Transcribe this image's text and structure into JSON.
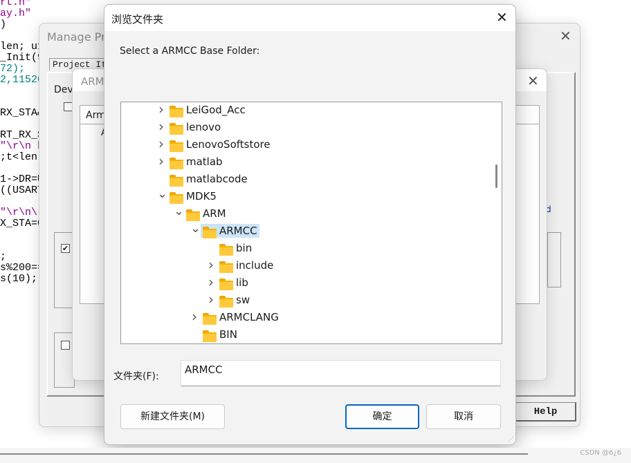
{
  "code_lines": [
    {
      "t": "rt.h\"",
      "c": "s"
    },
    {
      "t": "ay.h\"",
      "c": "s"
    },
    {
      "t": ")",
      "c": ""
    },
    {
      "t": "",
      "c": ""
    },
    {
      "t": "len; u1",
      "c": ""
    },
    {
      "t": "_Init(9",
      "c": ""
    },
    {
      "t": "72);",
      "c": "n"
    },
    {
      "t": "2,11520",
      "c": "n"
    },
    {
      "t": "",
      "c": ""
    },
    {
      "t": "",
      "c": ""
    },
    {
      "t": "RX_STA&",
      "c": ""
    },
    {
      "t": "",
      "c": ""
    },
    {
      "t": "RT_RX_S",
      "c": ""
    },
    {
      "t": "\"\\r\\n h",
      "c": "s"
    },
    {
      "t": ";t<len;",
      "c": ""
    },
    {
      "t": "",
      "c": ""
    },
    {
      "t": "1->DR=U",
      "c": ""
    },
    {
      "t": "((USART",
      "c": ""
    },
    {
      "t": "",
      "c": ""
    },
    {
      "t": "\"\\r\\n\\r",
      "c": "s"
    },
    {
      "t": "X_STA=0",
      "c": ""
    },
    {
      "t": "",
      "c": ""
    },
    {
      "t": "",
      "c": ""
    },
    {
      "t": ";",
      "c": ""
    },
    {
      "t": "s%200==",
      "c": ""
    },
    {
      "t": "s(10);",
      "c": ""
    }
  ],
  "manage_window": {
    "title": "Manage Pro",
    "tab": "Project Ite",
    "device_label": "Deve",
    "help_button": "Help",
    "partial_right": "d"
  },
  "arm_window": {
    "title": "ARM",
    "list_header": "Arm",
    "list_item": "A"
  },
  "dialog": {
    "title": "浏览文件夹",
    "prompt": "Select a ARMCC Base Folder:",
    "tree": [
      {
        "label": "LeiGod_Acc",
        "level": 0,
        "expander": "collapsed"
      },
      {
        "label": "lenovo",
        "level": 0,
        "expander": "collapsed"
      },
      {
        "label": "LenovoSoftstore",
        "level": 0,
        "expander": "collapsed"
      },
      {
        "label": "matlab",
        "level": 0,
        "expander": "collapsed"
      },
      {
        "label": "matlabcode",
        "level": 0,
        "expander": "none"
      },
      {
        "label": "MDK5",
        "level": 0,
        "expander": "expanded"
      },
      {
        "label": "ARM",
        "level": 1,
        "expander": "expanded"
      },
      {
        "label": "ARMCC",
        "level": 2,
        "expander": "expanded",
        "selected": true
      },
      {
        "label": "bin",
        "level": 3,
        "expander": "none"
      },
      {
        "label": "include",
        "level": 3,
        "expander": "collapsed"
      },
      {
        "label": "lib",
        "level": 3,
        "expander": "collapsed"
      },
      {
        "label": "sw",
        "level": 3,
        "expander": "collapsed"
      },
      {
        "label": "ARMCLANG",
        "level": 2,
        "expander": "collapsed"
      },
      {
        "label": "BIN",
        "level": 2,
        "expander": "none"
      }
    ],
    "folder_label": "文件夹(F):",
    "folder_value": "ARMCC",
    "new_folder_button": "新建文件夹(M)",
    "ok_button": "确定",
    "cancel_button": "取消",
    "accent": "#0067c0",
    "selection_color": "#cce4f7"
  },
  "watermark": "CSDN @6¿6"
}
